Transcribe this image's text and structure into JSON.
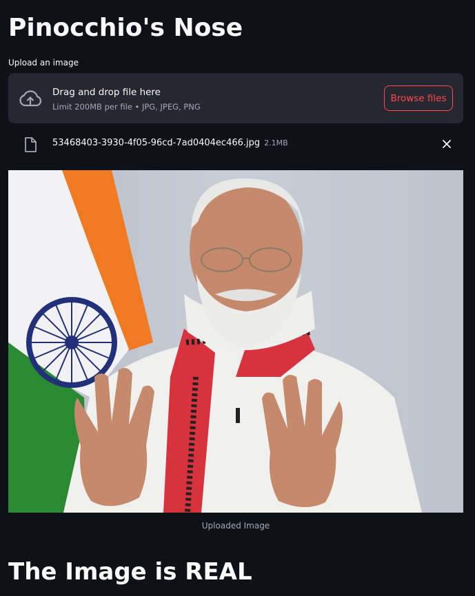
{
  "app": {
    "title": "Pinocchio's Nose"
  },
  "uploader": {
    "label": "Upload an image",
    "dropzone_title": "Drag and drop file here",
    "dropzone_limit": "Limit 200MB per file • JPG, JPEG, PNG",
    "browse_label": "Browse files",
    "upload_icon": "cloud-upload-icon"
  },
  "uploaded_file": {
    "name": "53468403-3930-4f05-96cd-7ad0404ec466.jpg",
    "size": "2.1MB",
    "file_icon": "file-icon",
    "remove_icon": "close-icon"
  },
  "image": {
    "caption": "Uploaded Image"
  },
  "result": {
    "heading": "The Image is REAL"
  },
  "colors": {
    "background": "#0e1117",
    "dropzone": "#262730",
    "accent": "#ff4b4b",
    "muted_text": "#a3a8b8"
  }
}
